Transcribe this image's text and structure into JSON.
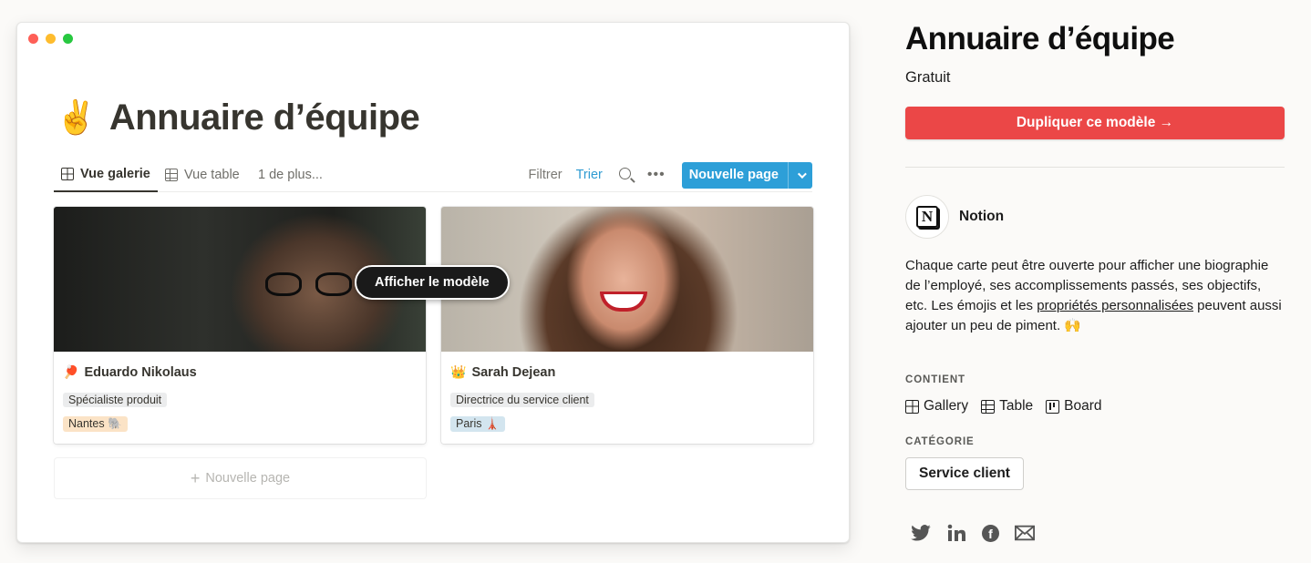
{
  "preview": {
    "page_emoji": "✌️",
    "page_title": "Annuaire d’équipe",
    "tabs": [
      {
        "label": "Vue galerie",
        "icon": "gallery-icon"
      },
      {
        "label": "Vue table",
        "icon": "table-icon"
      }
    ],
    "more_views": "1 de plus...",
    "filter": "Filtrer",
    "sort": "Trier",
    "new_page_button": "Nouvelle page",
    "overlay_button": "Afficher le modèle",
    "cards": [
      {
        "emoji": "🏓",
        "name": "Eduardo Nikolaus",
        "role": "Spécialiste produit",
        "city": "Nantes 🐘"
      },
      {
        "emoji": "👑",
        "name": "Sarah Dejean",
        "role": "Directrice du service client",
        "city": "Paris 🗼"
      }
    ],
    "add_page": "Nouvelle page"
  },
  "panel": {
    "title": "Annuaire d’équipe",
    "price": "Gratuit",
    "duplicate_button": "Dupliquer ce modèle →",
    "author": "Notion",
    "description": {
      "part1": "Chaque carte peut être ouverte pour afficher une biographie de l’employé, ses accomplissements passés, ses objectifs, etc. Les émojis et les ",
      "link": "propriétés personnalisées",
      "part2": " peuvent aussi ajouter un peu de piment. 🙌"
    },
    "contains_label": "CONTIENT",
    "contains": [
      {
        "label": "Gallery",
        "icon": "gallery-icon"
      },
      {
        "label": "Table",
        "icon": "table-icon"
      },
      {
        "label": "Board",
        "icon": "board-icon"
      }
    ],
    "category_label": "CATÉGORIE",
    "category": "Service client",
    "social": [
      "twitter-icon",
      "linkedin-icon",
      "facebook-icon",
      "email-icon"
    ]
  },
  "colors": {
    "accent_red": "#eb4747",
    "notion_blue": "#2d9fd8"
  }
}
